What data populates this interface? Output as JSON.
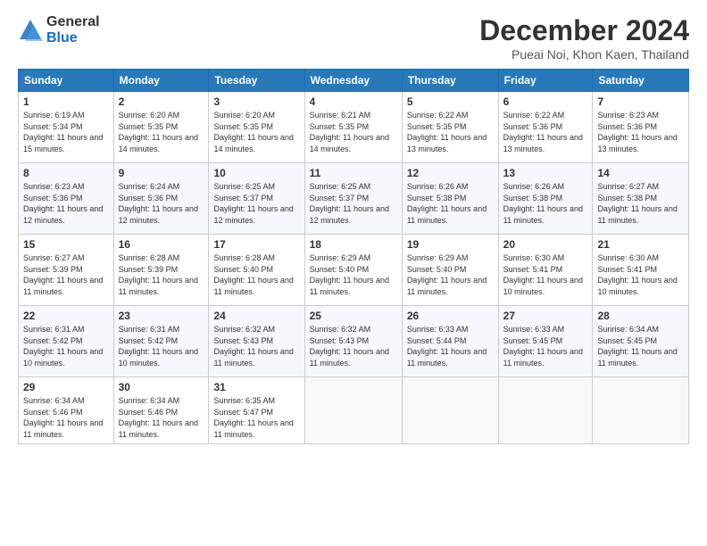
{
  "logo": {
    "general": "General",
    "blue": "Blue"
  },
  "header": {
    "month": "December 2024",
    "location": "Pueai Noi, Khon Kaen, Thailand"
  },
  "weekdays": [
    "Sunday",
    "Monday",
    "Tuesday",
    "Wednesday",
    "Thursday",
    "Friday",
    "Saturday"
  ],
  "weeks": [
    [
      {
        "day": "1",
        "sunrise": "Sunrise: 6:19 AM",
        "sunset": "Sunset: 5:34 PM",
        "daylight": "Daylight: 11 hours and 15 minutes."
      },
      {
        "day": "2",
        "sunrise": "Sunrise: 6:20 AM",
        "sunset": "Sunset: 5:35 PM",
        "daylight": "Daylight: 11 hours and 14 minutes."
      },
      {
        "day": "3",
        "sunrise": "Sunrise: 6:20 AM",
        "sunset": "Sunset: 5:35 PM",
        "daylight": "Daylight: 11 hours and 14 minutes."
      },
      {
        "day": "4",
        "sunrise": "Sunrise: 6:21 AM",
        "sunset": "Sunset: 5:35 PM",
        "daylight": "Daylight: 11 hours and 14 minutes."
      },
      {
        "day": "5",
        "sunrise": "Sunrise: 6:22 AM",
        "sunset": "Sunset: 5:35 PM",
        "daylight": "Daylight: 11 hours and 13 minutes."
      },
      {
        "day": "6",
        "sunrise": "Sunrise: 6:22 AM",
        "sunset": "Sunset: 5:36 PM",
        "daylight": "Daylight: 11 hours and 13 minutes."
      },
      {
        "day": "7",
        "sunrise": "Sunrise: 6:23 AM",
        "sunset": "Sunset: 5:36 PM",
        "daylight": "Daylight: 11 hours and 13 minutes."
      }
    ],
    [
      {
        "day": "8",
        "sunrise": "Sunrise: 6:23 AM",
        "sunset": "Sunset: 5:36 PM",
        "daylight": "Daylight: 11 hours and 12 minutes."
      },
      {
        "day": "9",
        "sunrise": "Sunrise: 6:24 AM",
        "sunset": "Sunset: 5:36 PM",
        "daylight": "Daylight: 11 hours and 12 minutes."
      },
      {
        "day": "10",
        "sunrise": "Sunrise: 6:25 AM",
        "sunset": "Sunset: 5:37 PM",
        "daylight": "Daylight: 11 hours and 12 minutes."
      },
      {
        "day": "11",
        "sunrise": "Sunrise: 6:25 AM",
        "sunset": "Sunset: 5:37 PM",
        "daylight": "Daylight: 11 hours and 12 minutes."
      },
      {
        "day": "12",
        "sunrise": "Sunrise: 6:26 AM",
        "sunset": "Sunset: 5:38 PM",
        "daylight": "Daylight: 11 hours and 11 minutes."
      },
      {
        "day": "13",
        "sunrise": "Sunrise: 6:26 AM",
        "sunset": "Sunset: 5:38 PM",
        "daylight": "Daylight: 11 hours and 11 minutes."
      },
      {
        "day": "14",
        "sunrise": "Sunrise: 6:27 AM",
        "sunset": "Sunset: 5:38 PM",
        "daylight": "Daylight: 11 hours and 11 minutes."
      }
    ],
    [
      {
        "day": "15",
        "sunrise": "Sunrise: 6:27 AM",
        "sunset": "Sunset: 5:39 PM",
        "daylight": "Daylight: 11 hours and 11 minutes."
      },
      {
        "day": "16",
        "sunrise": "Sunrise: 6:28 AM",
        "sunset": "Sunset: 5:39 PM",
        "daylight": "Daylight: 11 hours and 11 minutes."
      },
      {
        "day": "17",
        "sunrise": "Sunrise: 6:28 AM",
        "sunset": "Sunset: 5:40 PM",
        "daylight": "Daylight: 11 hours and 11 minutes."
      },
      {
        "day": "18",
        "sunrise": "Sunrise: 6:29 AM",
        "sunset": "Sunset: 5:40 PM",
        "daylight": "Daylight: 11 hours and 11 minutes."
      },
      {
        "day": "19",
        "sunrise": "Sunrise: 6:29 AM",
        "sunset": "Sunset: 5:40 PM",
        "daylight": "Daylight: 11 hours and 11 minutes."
      },
      {
        "day": "20",
        "sunrise": "Sunrise: 6:30 AM",
        "sunset": "Sunset: 5:41 PM",
        "daylight": "Daylight: 11 hours and 10 minutes."
      },
      {
        "day": "21",
        "sunrise": "Sunrise: 6:30 AM",
        "sunset": "Sunset: 5:41 PM",
        "daylight": "Daylight: 11 hours and 10 minutes."
      }
    ],
    [
      {
        "day": "22",
        "sunrise": "Sunrise: 6:31 AM",
        "sunset": "Sunset: 5:42 PM",
        "daylight": "Daylight: 11 hours and 10 minutes."
      },
      {
        "day": "23",
        "sunrise": "Sunrise: 6:31 AM",
        "sunset": "Sunset: 5:42 PM",
        "daylight": "Daylight: 11 hours and 10 minutes."
      },
      {
        "day": "24",
        "sunrise": "Sunrise: 6:32 AM",
        "sunset": "Sunset: 5:43 PM",
        "daylight": "Daylight: 11 hours and 11 minutes."
      },
      {
        "day": "25",
        "sunrise": "Sunrise: 6:32 AM",
        "sunset": "Sunset: 5:43 PM",
        "daylight": "Daylight: 11 hours and 11 minutes."
      },
      {
        "day": "26",
        "sunrise": "Sunrise: 6:33 AM",
        "sunset": "Sunset: 5:44 PM",
        "daylight": "Daylight: 11 hours and 11 minutes."
      },
      {
        "day": "27",
        "sunrise": "Sunrise: 6:33 AM",
        "sunset": "Sunset: 5:45 PM",
        "daylight": "Daylight: 11 hours and 11 minutes."
      },
      {
        "day": "28",
        "sunrise": "Sunrise: 6:34 AM",
        "sunset": "Sunset: 5:45 PM",
        "daylight": "Daylight: 11 hours and 11 minutes."
      }
    ],
    [
      {
        "day": "29",
        "sunrise": "Sunrise: 6:34 AM",
        "sunset": "Sunset: 5:46 PM",
        "daylight": "Daylight: 11 hours and 11 minutes."
      },
      {
        "day": "30",
        "sunrise": "Sunrise: 6:34 AM",
        "sunset": "Sunset: 5:46 PM",
        "daylight": "Daylight: 11 hours and 11 minutes."
      },
      {
        "day": "31",
        "sunrise": "Sunrise: 6:35 AM",
        "sunset": "Sunset: 5:47 PM",
        "daylight": "Daylight: 11 hours and 11 minutes."
      },
      null,
      null,
      null,
      null
    ]
  ]
}
